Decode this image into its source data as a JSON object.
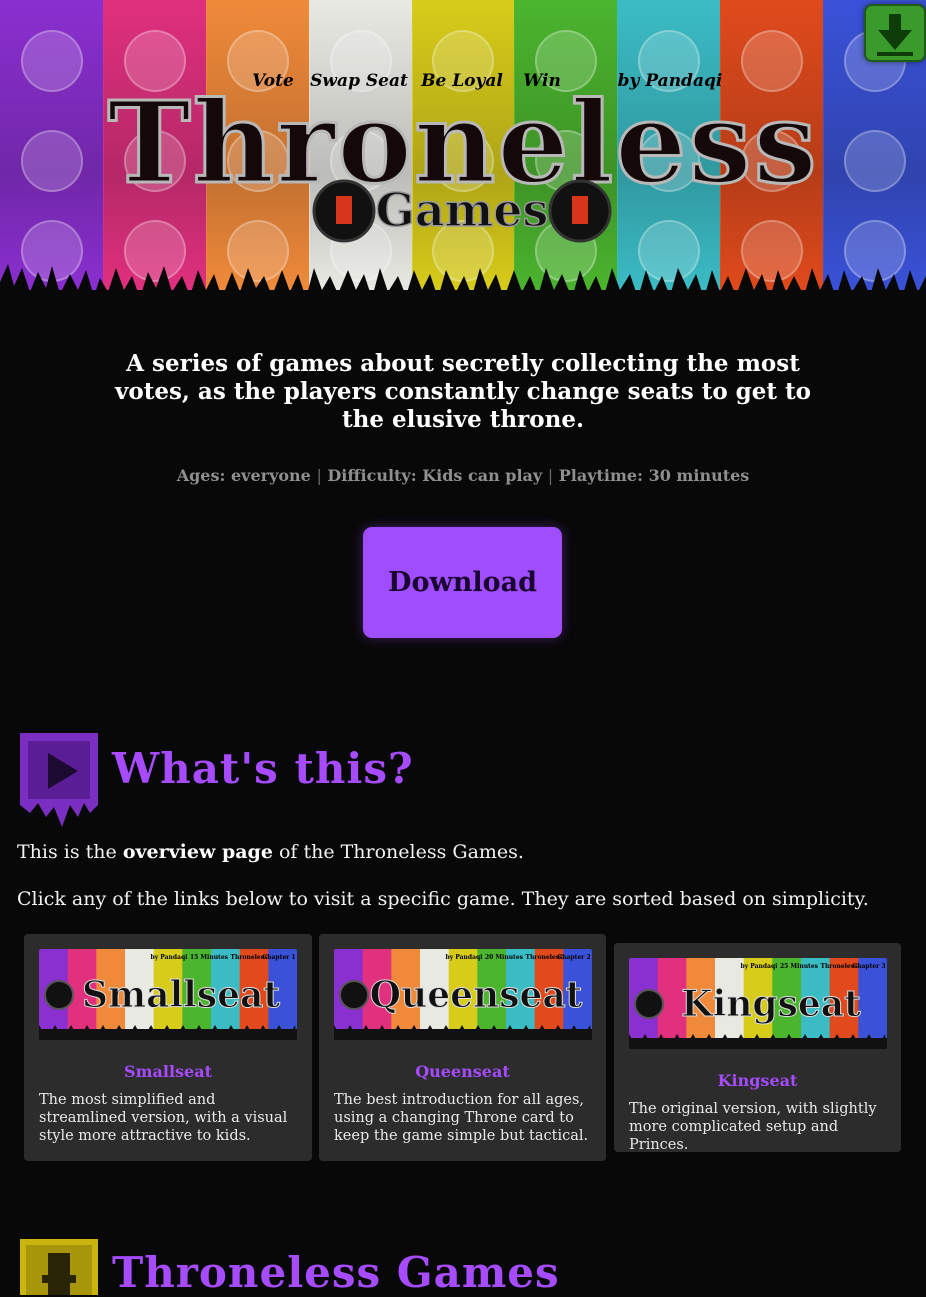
{
  "header": {
    "logo_title": "Throneless",
    "logo_games": "Games",
    "banner_words": [
      "Vote",
      "Swap Seat",
      "Be Loyal",
      "Win",
      "by Pandaqi"
    ],
    "banner_colors": [
      "#8a2fd0",
      "#e0307e",
      "#f08a3a",
      "#e9e9e4",
      "#d8cc1a",
      "#4bb52e",
      "#3bbcc5",
      "#e04a1c",
      "#3a52d8"
    ],
    "download_corner_icon": "download-arrow-icon"
  },
  "intro": {
    "tagline": "A series of games about secretly collecting the most votes, as the players constantly change seats to get to the elusive throne.",
    "meta": {
      "ages_label": "Ages:",
      "ages": "everyone",
      "difficulty_label": "Difficulty:",
      "difficulty": "Kids can play",
      "playtime_label": "Playtime:",
      "playtime": "30 minutes",
      "separator": "|"
    },
    "download_label": "Download"
  },
  "whats_this": {
    "icon": "play-icon",
    "title": "What's this?",
    "p1_before": "This is the ",
    "p1_bold": "overview page",
    "p1_after": " of the Throneless Games.",
    "p2": "Click any of the links below to visit a specific game. They are sorted based on simplicity."
  },
  "games": [
    {
      "name": "Smallseat",
      "logo_text": "Smallseat",
      "banner_tags": [
        "by Pandaqi",
        "15 Minutes",
        "Throneless",
        "Chapter 1"
      ],
      "description": "The most simplified and streamlined version, with a visual style more attractive to kids."
    },
    {
      "name": "Queenseat",
      "logo_text": "Queenseat",
      "banner_tags": [
        "by Pandaqi",
        "20 Minutes",
        "Throneless",
        "Chapter 2"
      ],
      "description": "The best introduction for all ages, using a changing Throne card to keep the game simple but tactical."
    },
    {
      "name": "Kingseat",
      "logo_text": "Kingseat",
      "banner_tags": [
        "by Pandaqi",
        "25 Minutes",
        "Throneless",
        "Chapter 3"
      ],
      "description": "The original version, with slightly more complicated setup and Princes."
    }
  ],
  "next_section": {
    "icon": "throne-icon",
    "title": "Throneless Games"
  },
  "colors": {
    "accent": "#a64bff",
    "button": "#a04cff",
    "background": "#080808",
    "card": "#2c2c2c"
  }
}
